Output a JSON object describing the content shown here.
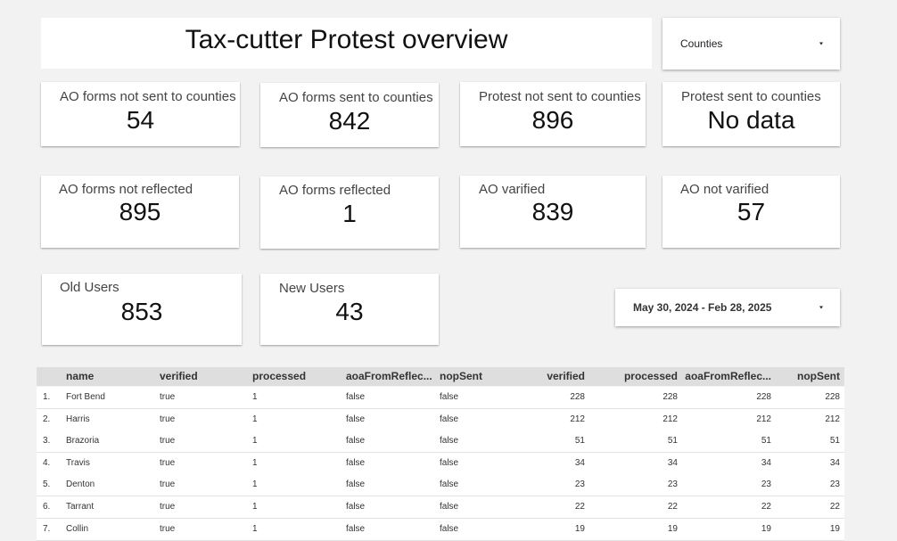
{
  "title": "Tax-cutter Protest overview",
  "counties_dropdown": {
    "label": "Counties"
  },
  "date_range": {
    "label": "May 30, 2024 - Feb 28, 2025"
  },
  "kpis": {
    "ao_not_sent": {
      "label": "AO forms not sent to counties",
      "value": "54"
    },
    "ao_sent": {
      "label": "AO forms sent to counties",
      "value": "842"
    },
    "protest_not_sent": {
      "label": "Protest not sent to counties",
      "value": "896"
    },
    "protest_sent": {
      "label": "Protest sent to counties",
      "value": "No data"
    },
    "ao_not_reflected": {
      "label": "AO forms not reflected",
      "value": "895"
    },
    "ao_reflected": {
      "label": "AO forms reflected",
      "value": "1"
    },
    "ao_verified": {
      "label": "AO varified",
      "value": "839"
    },
    "ao_not_verified": {
      "label": "AO not varified",
      "value": "57"
    },
    "old_users": {
      "label": "Old Users",
      "value": "853"
    },
    "new_users": {
      "label": "New Users",
      "value": "43"
    }
  },
  "table": {
    "headers": [
      "name",
      "verified",
      "processed",
      "aoaFromReflec...",
      "nopSent",
      "verified",
      "processed",
      "aoaFromReflec...",
      "nopSent"
    ],
    "rows": [
      [
        "1.",
        "Fort Bend",
        "true",
        "1",
        "false",
        "false",
        "228",
        "228",
        "228",
        "228"
      ],
      [
        "2.",
        "Harris",
        "true",
        "1",
        "false",
        "false",
        "212",
        "212",
        "212",
        "212"
      ],
      [
        "3.",
        "Brazoria",
        "true",
        "1",
        "false",
        "false",
        "51",
        "51",
        "51",
        "51"
      ],
      [
        "4.",
        "Travis",
        "true",
        "1",
        "false",
        "false",
        "34",
        "34",
        "34",
        "34"
      ],
      [
        "5.",
        "Denton",
        "true",
        "1",
        "false",
        "false",
        "23",
        "23",
        "23",
        "23"
      ],
      [
        "6.",
        "Tarrant",
        "true",
        "1",
        "false",
        "false",
        "22",
        "22",
        "22",
        "22"
      ],
      [
        "7.",
        "Collin",
        "true",
        "1",
        "false",
        "false",
        "19",
        "19",
        "19",
        "19"
      ]
    ]
  }
}
